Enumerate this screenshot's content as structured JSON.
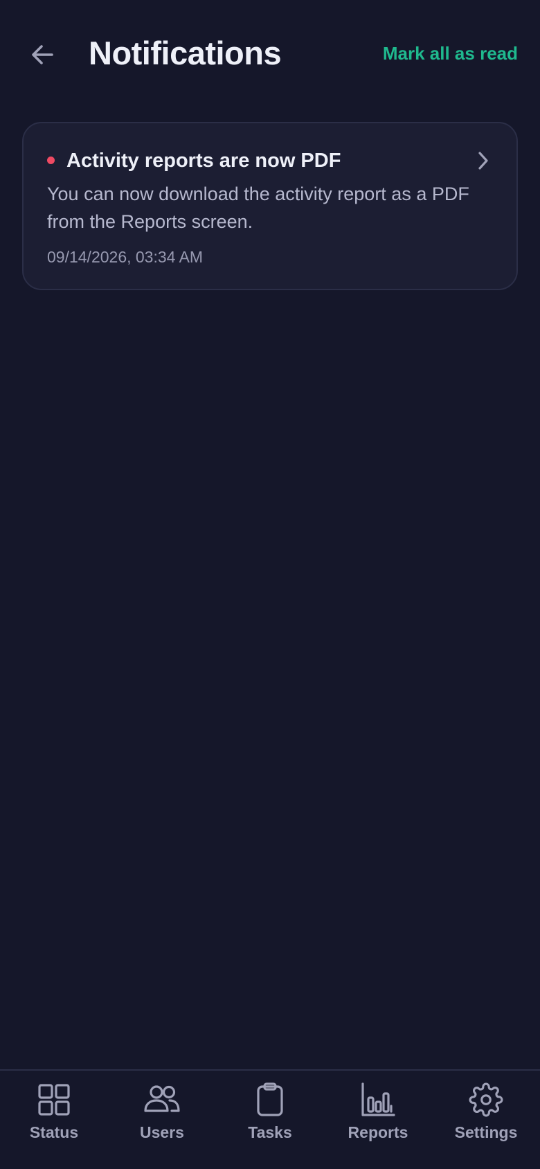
{
  "header": {
    "title": "Notifications",
    "mark_all_label": "Mark all as read",
    "back_icon": "arrow-left-icon"
  },
  "notifications": [
    {
      "title": "Activity reports are now PDF",
      "body": "You can now download the activity report as a PDF from the Reports screen.",
      "timestamp": "09/14/2026, 03:34 AM",
      "unread": true
    }
  ],
  "bottom_nav": {
    "items": [
      {
        "label": "Status",
        "icon": "grid-icon"
      },
      {
        "label": "Users",
        "icon": "users-icon"
      },
      {
        "label": "Tasks",
        "icon": "clipboard-icon"
      },
      {
        "label": "Reports",
        "icon": "bar-chart-icon"
      },
      {
        "label": "Settings",
        "icon": "gear-icon"
      }
    ]
  },
  "colors": {
    "background": "#15172a",
    "card": "#1c1e33",
    "accent": "#1fb98e",
    "unread_dot": "#ef4a63",
    "muted_text": "#b6b8ce"
  }
}
